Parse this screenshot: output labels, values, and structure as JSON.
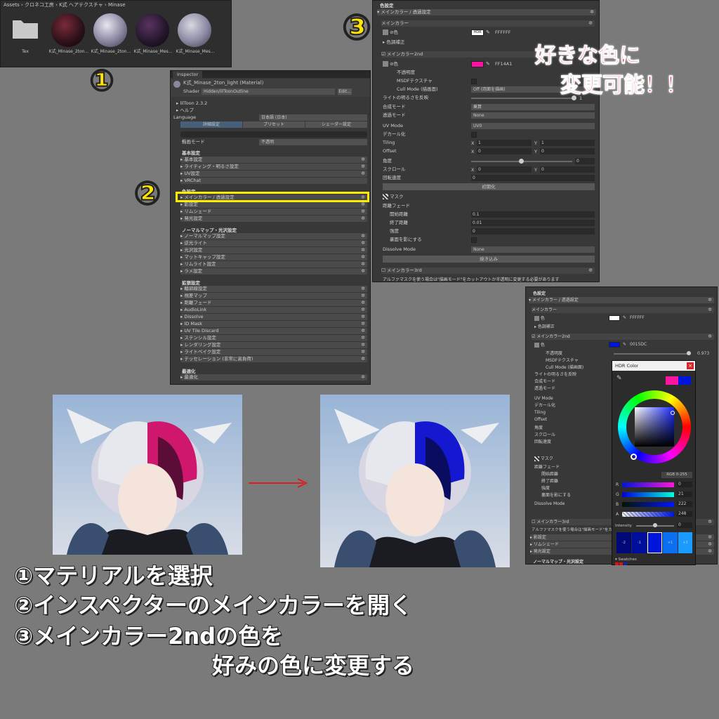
{
  "project": {
    "breadcrumb": [
      "Assets",
      "クロネコ工房",
      "K式 ヘアテクスチャ",
      "Minase"
    ],
    "items": [
      {
        "label": "Tex"
      },
      {
        "label": "K式_Minase_2ton..."
      },
      {
        "label": "K式_Minase_2ton..."
      },
      {
        "label": "K式_Minase_Mes..."
      },
      {
        "label": "K式_Minase_Mes..."
      }
    ]
  },
  "inspector": {
    "tab": "Inspector",
    "material_name": "K式_Minase_2ton_light (Material)",
    "shader_label": "Shader",
    "shader_value": "Hidden/lilToonOutline",
    "edit_button": "Edit...",
    "version": "lilToon 2.3.2",
    "help": "ヘルプ",
    "language_label": "Language",
    "language_value": "日本語 (日本)",
    "tabs": [
      "詳細設定",
      "プリセット",
      "シェーダー設定"
    ],
    "render_mode_label": "描画モード",
    "render_mode_value": "不透明",
    "groups": [
      {
        "title": "基本設定",
        "items": [
          "基本設定",
          "ライティング・明るさ設定",
          "UV設定",
          "VRChat"
        ]
      },
      {
        "title": "色設定",
        "items": [
          "メインカラー / 透過設定",
          "影設定",
          "リムシェード",
          "発光設定"
        ]
      },
      {
        "title": "ノーマルマップ・光沢設定",
        "items": [
          "ノーマルマップ設定",
          "逆光ライト",
          "光沢設定",
          "マットキャップ設定",
          "リムライト設定",
          "ラメ設定"
        ]
      },
      {
        "title": "拡張設定",
        "items": [
          "輪郭線設定",
          "視差マップ",
          "距離フェード",
          "AudioLink",
          "Dissolve",
          "ID Mask",
          "UV Tile Discard",
          "ステンシル設定",
          "レンダリング設定",
          "ライトベイク設定",
          "テッセレーション (非常に高負荷)"
        ]
      },
      {
        "title": "最適化",
        "items": [
          "最適化"
        ]
      }
    ]
  },
  "main_color": {
    "header": "色設定",
    "section": "メインカラー / 透過設定",
    "sub_main": "メインカラー",
    "color_label": "色",
    "hdr": "HDR",
    "main_hex": "FFFFFF",
    "color_correction": "色調補正",
    "second_title": "メインカラー2nd",
    "second_hex": "FF14A1",
    "second_hex_after": "0015DC",
    "opacity_label": "不透明度",
    "opacity_value": "0.973",
    "msdf_label": "MSDFテクスチャ",
    "cull_label": "Cull Mode (描画面)",
    "cull_value": "Off (両面を描画)",
    "light_label": "ライトの明るさを反映",
    "light_value": "1",
    "blend_label": "合成モード",
    "blend_value": "乗算",
    "alpha_mode_label": "透過モード",
    "alpha_mode_value": "None",
    "uv_mode_label": "UV Mode",
    "uv_mode_value": "UV0",
    "decal_label": "デカール化",
    "tiling_label": "Tiling",
    "tiling_x": "1",
    "tiling_y": "1",
    "offset_label": "Offset",
    "offset_x": "0",
    "offset_y": "0",
    "angle_label": "角度",
    "angle_value": "0",
    "scroll_label": "スクロール",
    "scroll_x": "0",
    "scroll_y": "0",
    "rotate_label": "回転速度",
    "rotate_value": "0",
    "init_button": "初期化",
    "mask_label": "マスク",
    "distance_fade": "距離フェード",
    "fade_start_label": "開始距離",
    "fade_start": "0.1",
    "fade_end_label": "終了距離",
    "fade_end": "0.01",
    "strength_label": "強度",
    "strength": "0",
    "backface_label": "裏面を影にする",
    "dissolve_label": "Dissolve Mode",
    "dissolve_value": "None",
    "bake_button": "焼き込み",
    "third_title": "メインカラー3rd",
    "footer_note": "アルファマスクを使う場合は\"描画モード\"をカットアウトか半透明に変更する必要があります"
  },
  "color_picker": {
    "title": "HDR Color",
    "mode": "RGB 0-255",
    "r_label": "R",
    "r": "0",
    "g_label": "G",
    "g": "21",
    "b_label": "B",
    "b": "222",
    "a_label": "A",
    "a": "248",
    "intensity_label": "Intensity",
    "intensity": "0",
    "intensity_stops": [
      "-2",
      "-1",
      "",
      "+1",
      "+2"
    ],
    "swatches_label": "Swatches",
    "lower_items": [
      "影設定",
      "リムシェード",
      "発光設定"
    ],
    "lower_group": "ノーマルマップ・光沢設定"
  },
  "annotations": {
    "num1": "①",
    "num2": "②",
    "num3": "③",
    "callout_line1": "好きな色に",
    "callout_line2": "変更可能！！",
    "step1": "①マテリアルを選択",
    "step2": "②インスペクターのメインカラーを開く",
    "step3": "③メインカラー2ndの色を",
    "step3b": "好みの色に変更する"
  },
  "colors": {
    "pink": "#ff14a1",
    "blue": "#0015dc",
    "highlight": "#ffee00",
    "arrow": "#d92020"
  }
}
